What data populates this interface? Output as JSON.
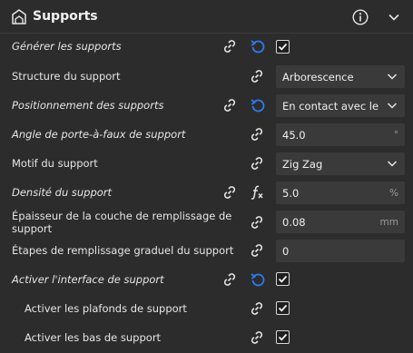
{
  "section": {
    "title": "Supports"
  },
  "rows": [
    {
      "label": "Générer les supports"
    },
    {
      "label": "Structure du support",
      "value": "Arborescence"
    },
    {
      "label": "Positionnement des supports",
      "value": "En contact avec le plateau"
    },
    {
      "label": "Angle de porte-à-faux de support",
      "value": "45.0",
      "unit": "°"
    },
    {
      "label": "Motif du support",
      "value": "Zig Zag"
    },
    {
      "label": "Densité du support",
      "value": "5.0",
      "unit": "%"
    },
    {
      "label": "Épaisseur de la couche de remplissage de support",
      "value": "0.08",
      "unit": "mm"
    },
    {
      "label": "Étapes de remplissage graduel du support",
      "value": "0"
    },
    {
      "label": "Activer l'interface de support"
    },
    {
      "label": "Activer les plafonds de support"
    },
    {
      "label": "Activer les bas de support"
    }
  ],
  "colors": {
    "accent_blue": "#2e7bf0",
    "background": "#2c2c2c",
    "field_bg": "#3a3a3a"
  }
}
